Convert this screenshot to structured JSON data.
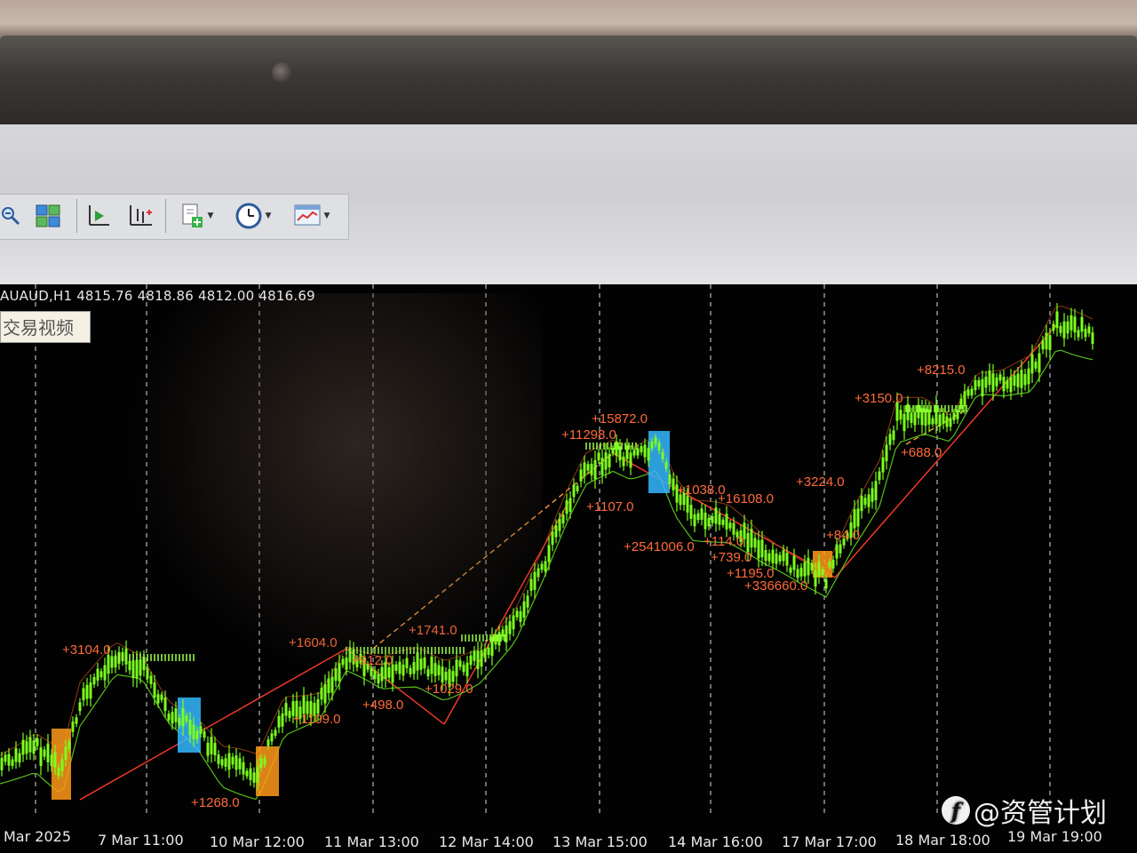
{
  "chart_header": {
    "symbol_line": "AUAUD,H1  4815.76 4818.86 4812.00 4816.69"
  },
  "overlay_label": "交易视频",
  "toolbar": {
    "icons": [
      "zoom-out-icon",
      "tile-windows-icon",
      "chart-shift-icon",
      "autoscroll-icon",
      "add-indicator-icon",
      "period-clock-icon",
      "templates-icon"
    ]
  },
  "watermark": {
    "logo_letter": "f",
    "text": "@资管计划"
  },
  "colors": {
    "background": "#020202",
    "candles": "#7cff1c",
    "profit_labels": "#ff6a3a",
    "trade_lines": "#ff3b2b",
    "grid": "#d8d8d8",
    "highlight_orange": "#ff9a1a",
    "highlight_blue": "#35b9ff"
  },
  "chart_data": {
    "type": "line",
    "symbol": "AUAUD",
    "timeframe": "H1",
    "ohlc": {
      "open": 4815.76,
      "high": 4818.86,
      "low": 4812.0,
      "close": 4816.69
    },
    "x_labels": [
      "Mar 2025",
      "7 Mar 11:00",
      "10 Mar 12:00",
      "11 Mar 13:00",
      "12 Mar 14:00",
      "13 Mar 15:00",
      "14 Mar 16:00",
      "17 Mar 17:00",
      "18 Mar 18:00",
      "19 Mar 19:00"
    ],
    "trade_labels": [
      "+3104.0",
      "+1268.0",
      "+1604.0",
      "+1109.0",
      "+912.0",
      "+498.0",
      "+1741.0",
      "+1029.0",
      "+11298.0",
      "+15872.0",
      "+1107.0",
      "+1038.0",
      "+16108.0",
      "+2541006.0",
      "+114.0",
      "+739.0",
      "+1195.0",
      "+336660.0",
      "+3224.0",
      "+84.0",
      "+3150.0",
      "+8215.0",
      "+688.0"
    ],
    "grid": true
  }
}
